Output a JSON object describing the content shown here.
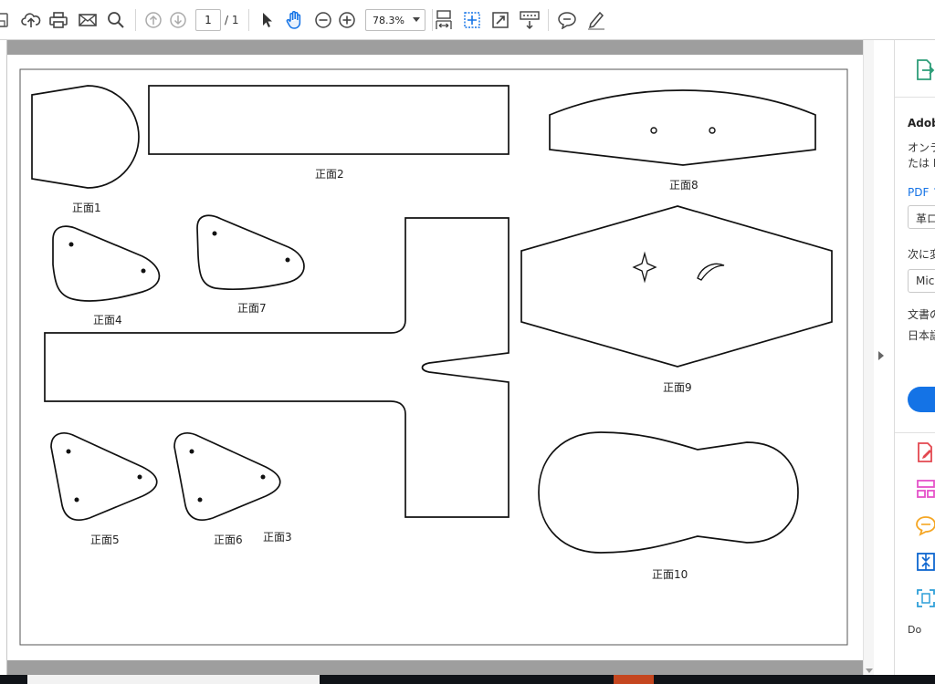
{
  "toolbar": {
    "page_current": "1",
    "page_total": "/ 1",
    "zoom": "78.3%"
  },
  "page": {
    "labels": [
      "正面1",
      "正面2",
      "正面3",
      "正面4",
      "正面5",
      "正面6",
      "正面7",
      "正面8",
      "正面9",
      "正面10"
    ]
  },
  "right_panel": {
    "title": "Adob",
    "desc_line1": "オンラ",
    "desc_line2": "たは E",
    "pdf_label": "PDF フ",
    "file_field": "革ロ",
    "convert_label": "次に変",
    "format_field": "Micr",
    "doc_lang_label": "文書の",
    "doc_lang_value": "日本語",
    "bottom_label": "Do"
  },
  "colors": {
    "accent": "#1473e6",
    "hand_tool": "#1473e6",
    "export_icon": "#2d9d78",
    "edit_icon": "#e34850",
    "organize_icon": "#e552c9",
    "comment_icon": "#f5a623",
    "compress_icon": "#0d66d0",
    "scan_icon": "#2d9fd8"
  }
}
